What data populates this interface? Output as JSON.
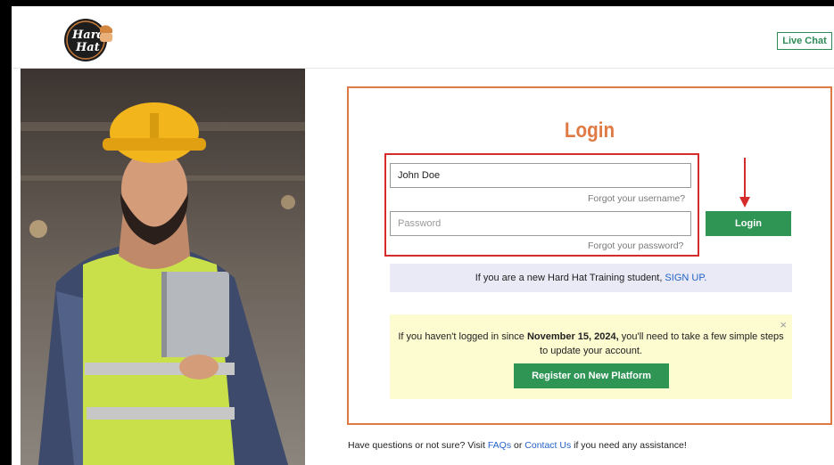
{
  "header": {
    "logo_alt": "Hard Hat",
    "live_chat_label": "Live Chat"
  },
  "login": {
    "title": "Login",
    "username_value": "John Doe",
    "forgot_username": "Forgot your username?",
    "password_placeholder": "Password",
    "forgot_password": "Forgot your password?",
    "button_label": "Login"
  },
  "signup": {
    "text": "If you are a new Hard Hat Training student,",
    "link": "SIGN UP."
  },
  "notice": {
    "line1_pre": "If you haven't logged in since",
    "line1_date": "November 15, 2024,",
    "line1_post": "you'll need to take a few simple steps",
    "line2": "to update your account.",
    "close_glyph": "×",
    "register_label": "Register on New Platform"
  },
  "footer": {
    "pre": "Have questions or not sure? Visit",
    "faqs": "FAQs",
    "or": "or",
    "contact": "Contact Us",
    "post": "if you need any assistance!"
  },
  "colors": {
    "accent_orange": "#e07a44",
    "button_green": "#2e9554",
    "highlight_red": "#d62b2b",
    "link_blue": "#2563c8",
    "notice_yellow": "#fdfbd0"
  }
}
